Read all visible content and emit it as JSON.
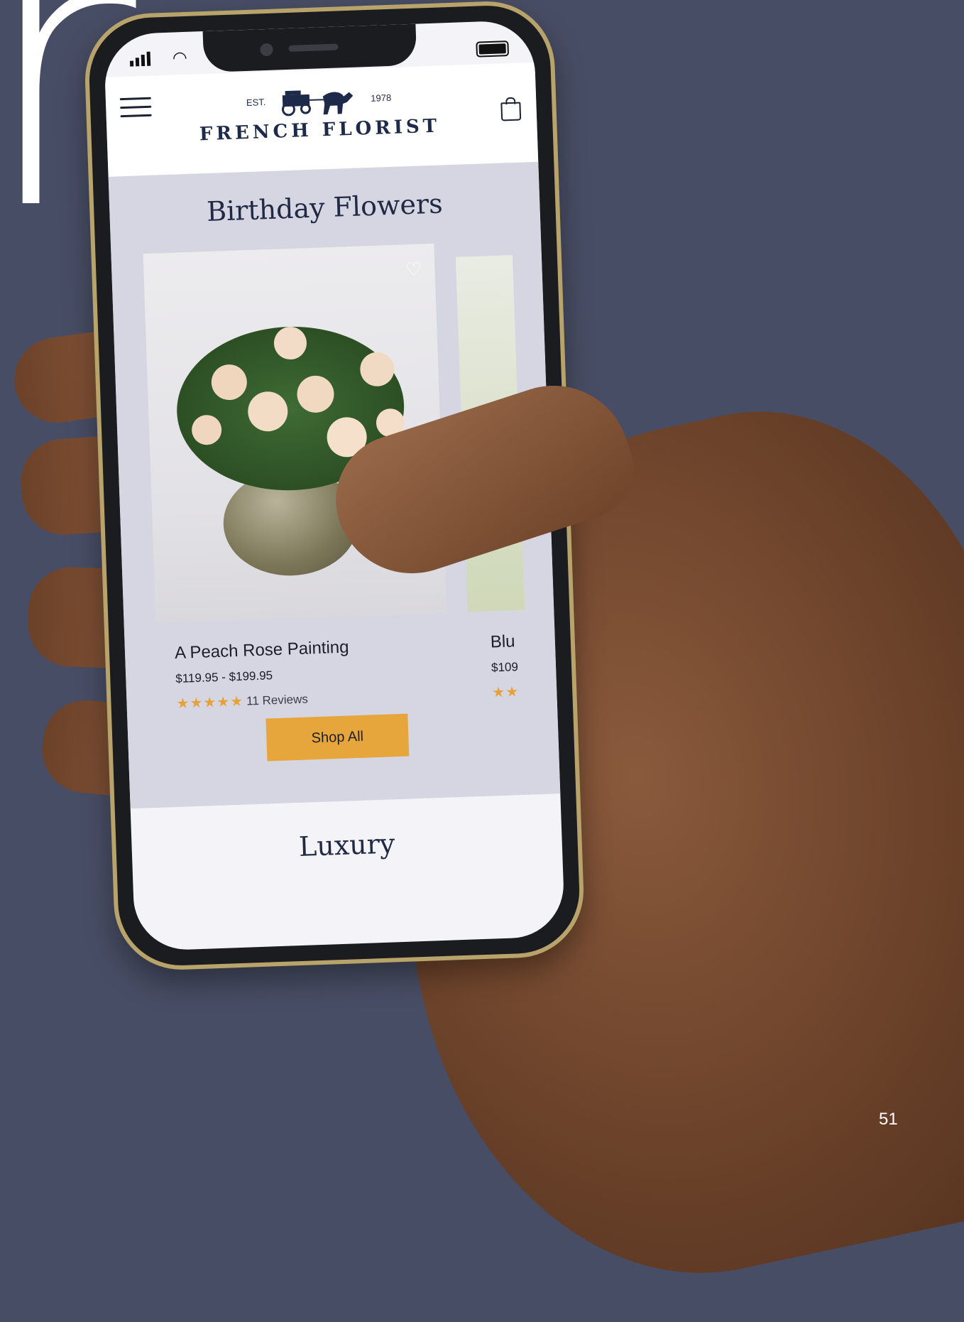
{
  "background": {
    "glyph_text": "r",
    "color": "#474d64"
  },
  "page_number": "51",
  "phone": {
    "status_bar": {
      "signal_icon": "signal-bars-icon",
      "wifi_icon": "wifi-icon",
      "battery_icon": "battery-icon"
    },
    "header": {
      "menu_icon": "hamburger-menu-icon",
      "logo": {
        "est_label": "EST.",
        "year": "1978",
        "name": "FRENCH FLORIST",
        "emblem": "horse-carriage-icon"
      },
      "cart_icon": "shopping-bag-icon"
    },
    "section": {
      "title": "Birthday Flowers",
      "products": [
        {
          "name": "A Peach Rose Painting",
          "price": "$119.95 - $199.95",
          "rating": 5,
          "reviews": "11 Reviews"
        },
        {
          "name": "Blu",
          "price": "$109"
        }
      ],
      "cta_label": "Shop All"
    },
    "next_section_title": "Luxury"
  },
  "colors": {
    "accent": "#e7a63b",
    "navy": "#202a44",
    "section_bg": "#d6d6e3"
  }
}
